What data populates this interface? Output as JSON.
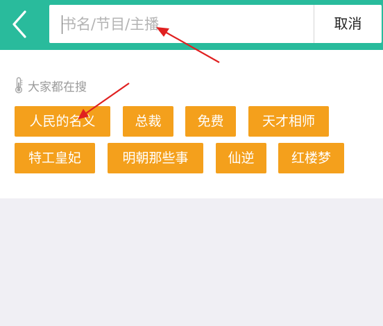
{
  "header": {
    "search_placeholder": "书名/节目/主播",
    "search_value": "",
    "cancel_label": "取消"
  },
  "hot_search": {
    "title": "大家都在搜",
    "tags": [
      {
        "label": "人民的名义"
      },
      {
        "label": "总裁"
      },
      {
        "label": "免费"
      },
      {
        "label": "天才相师"
      },
      {
        "label": "特工皇妃"
      },
      {
        "label": "明朝那些事"
      },
      {
        "label": "仙逆"
      },
      {
        "label": "红楼梦"
      }
    ]
  },
  "colors": {
    "header_bg": "#29bb9c",
    "tag_bg": "#f4a01c",
    "annotation_arrow": "#e02020",
    "page_bg": "#f0eff4"
  },
  "icons": {
    "back": "chevron-left-icon",
    "hot": "thermometer-icon"
  }
}
